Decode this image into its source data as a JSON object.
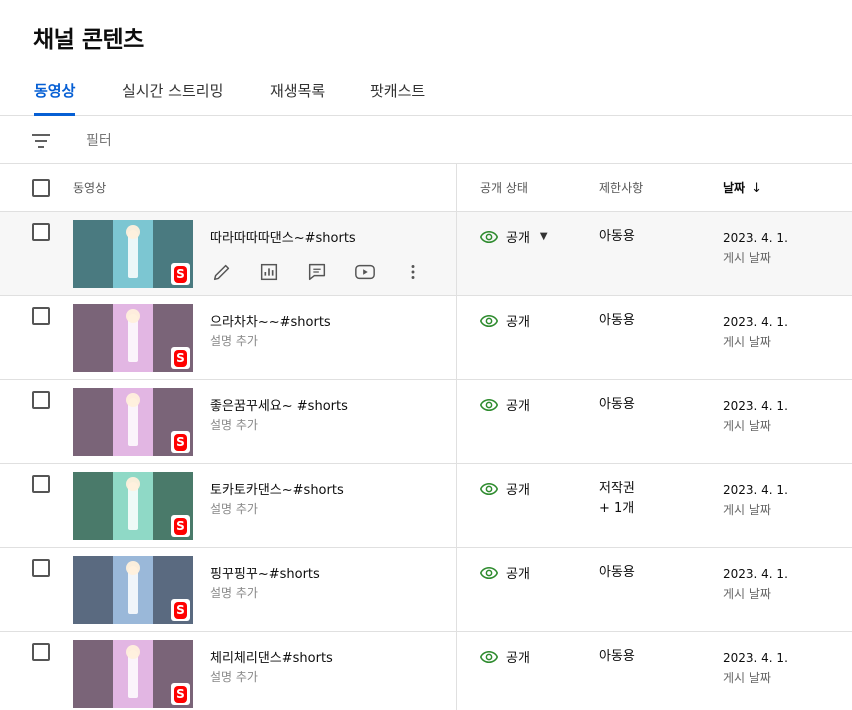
{
  "page_title": "채널 콘텐츠",
  "tabs": [
    {
      "label": "동영상",
      "active": true
    },
    {
      "label": "실시간 스트리밍",
      "active": false
    },
    {
      "label": "재생목록",
      "active": false
    },
    {
      "label": "팟캐스트",
      "active": false
    }
  ],
  "filter": {
    "label": "필터",
    "icon": "filter-icon"
  },
  "columns": {
    "video": "동영상",
    "visibility": "공개 상태",
    "restrictions": "제한사항",
    "date": "날짜",
    "date_sort_icon": "arrow-down-icon"
  },
  "colors": {
    "accent": "#065fd4",
    "visibility_icon": "#2e8b2e",
    "shorts_badge": "#ff0000"
  },
  "rows": [
    {
      "title": "따라따따따댄스~#shorts",
      "description": "",
      "visibility": "공개",
      "restriction": "아동용",
      "restriction_extra": "",
      "date": "2023. 4. 1.",
      "date_label": "게시 날짜",
      "thumb_color": "#4a7a80",
      "thumb_mid": "#7cc6d2",
      "hovered": true
    },
    {
      "title": "으라차차~~#shorts",
      "description": "설명 추가",
      "visibility": "공개",
      "restriction": "아동용",
      "restriction_extra": "",
      "date": "2023. 4. 1.",
      "date_label": "게시 날짜",
      "thumb_color": "#7a6478",
      "thumb_mid": "#e2b6e3"
    },
    {
      "title": "좋은꿈꾸세요~ #shorts",
      "description": "설명 추가",
      "visibility": "공개",
      "restriction": "아동용",
      "restriction_extra": "",
      "date": "2023. 4. 1.",
      "date_label": "게시 날짜",
      "thumb_color": "#7a6478",
      "thumb_mid": "#e2b6e3"
    },
    {
      "title": "토카토카댄스~#shorts",
      "description": "설명 추가",
      "visibility": "공개",
      "restriction": "저작권",
      "restriction_extra": "+ 1개",
      "date": "2023. 4. 1.",
      "date_label": "게시 날짜",
      "thumb_color": "#4a7a6a",
      "thumb_mid": "#8fd9c6"
    },
    {
      "title": "핑꾸핑꾸~#shorts",
      "description": "설명 추가",
      "visibility": "공개",
      "restriction": "아동용",
      "restriction_extra": "",
      "date": "2023. 4. 1.",
      "date_label": "게시 날짜",
      "thumb_color": "#5a6a80",
      "thumb_mid": "#9ab8d9"
    },
    {
      "title": "체리체리댄스#shorts",
      "description": "설명 추가",
      "visibility": "공개",
      "restriction": "아동용",
      "restriction_extra": "",
      "date": "2023. 4. 1.",
      "date_label": "게시 날짜",
      "thumb_color": "#7a6478",
      "thumb_mid": "#e2b6e3"
    }
  ],
  "row_actions": [
    "pencil-icon",
    "analytics-icon",
    "comments-icon",
    "youtube-icon",
    "more-vert-icon"
  ]
}
